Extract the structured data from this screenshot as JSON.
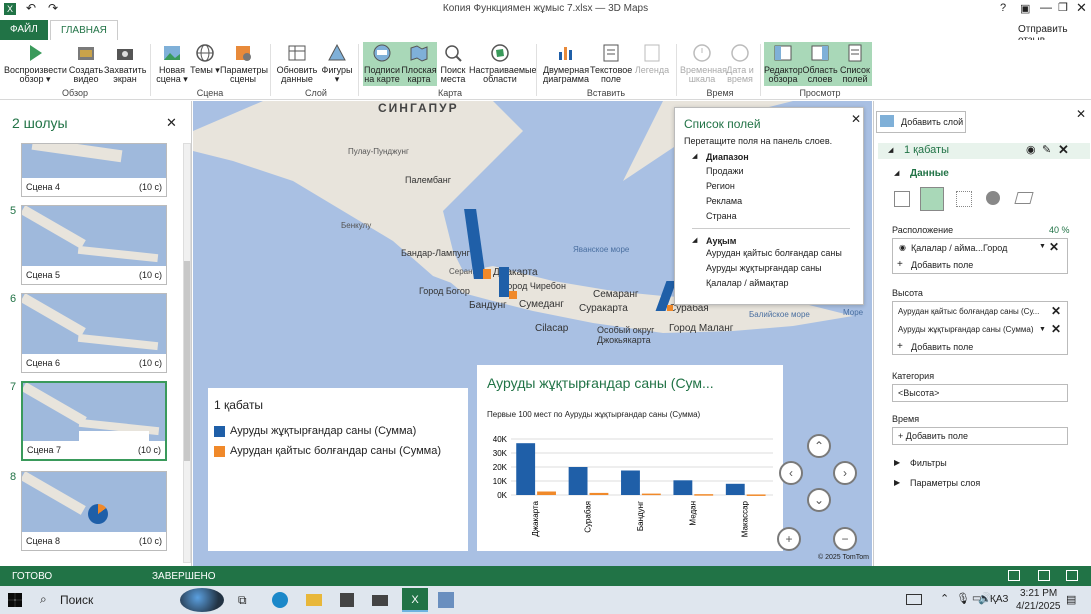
{
  "window": {
    "title": "Копия Функциямен жұмыс 7.xlsx — 3D Maps",
    "share": "Отправить отзыв"
  },
  "tabs": {
    "file": "ФАЙЛ",
    "home": "ГЛАВНАЯ"
  },
  "ribbon": {
    "buttons": [
      {
        "label": "Воспроизвести обзор ▾",
        "name": "play-tour-button"
      },
      {
        "label": "Создать видео",
        "name": "create-video-button"
      },
      {
        "label": "Захватить экран",
        "name": "capture-screen-button"
      },
      {
        "label": "Новая сцена ▾",
        "name": "new-scene-button"
      },
      {
        "label": "Темы ▾",
        "name": "themes-button"
      },
      {
        "label": "Параметры сцены",
        "name": "scene-options-button"
      },
      {
        "label": "Обновить данные",
        "name": "refresh-data-button"
      },
      {
        "label": "Фигуры ▾",
        "name": "shapes-button"
      },
      {
        "label": "Подписи на карте",
        "name": "map-labels-button"
      },
      {
        "label": "Плоская карта",
        "name": "flat-map-button"
      },
      {
        "label": "Поиск места",
        "name": "find-location-button"
      },
      {
        "label": "Настраиваемые области",
        "name": "custom-regions-button"
      },
      {
        "label": "Двумерная диаграмма",
        "name": "2d-chart-button"
      },
      {
        "label": "Текстовое поле",
        "name": "text-box-button"
      },
      {
        "label": "Легенда",
        "name": "legend-button"
      },
      {
        "label": "Временная шкала",
        "name": "timeline-button"
      },
      {
        "label": "Дата и время",
        "name": "date-time-button"
      },
      {
        "label": "Редактор обзора",
        "name": "tour-editor-button"
      },
      {
        "label": "Область слоев",
        "name": "layer-pane-button"
      },
      {
        "label": "Список полей",
        "name": "field-list-button"
      }
    ],
    "groups": [
      "Обзор",
      "Сцена",
      "Слой",
      "Карта",
      "Вставить",
      "Время",
      "Просмотр"
    ]
  },
  "left": {
    "header": "2 шолуы",
    "scenes": [
      {
        "num": "",
        "title": "Сцена 4",
        "dur": "(10 с)"
      },
      {
        "num": "5",
        "title": "Сцена 5",
        "dur": "(10 с)"
      },
      {
        "num": "6",
        "title": "Сцена 6",
        "dur": "(10 с)"
      },
      {
        "num": "7",
        "title": "Сцена 7",
        "dur": "(10 с)"
      },
      {
        "num": "8",
        "title": "Сцена 8",
        "dur": "(10 с)"
      }
    ]
  },
  "map": {
    "labels": [
      "СИНГАПУР",
      "Пулау-Пунджунг",
      "Палембанг",
      "Бенкулу",
      "Бандар-Лампунг",
      "Серанг",
      "Джакарта",
      "Город Богор",
      "Город Чиребон",
      "Бандунг",
      "Сумеданг",
      "Семаранг",
      "Суракарта",
      "Сурабая",
      "Город Маланг",
      "Cilacap",
      "Особый округ",
      "Джокьякарта",
      "Яванское море",
      "Балийское море",
      "Море"
    ],
    "copyright": "© 2025 TomTom",
    "field_list": {
      "title": "Список полей",
      "hint": "Перетащите поля на панель слоев.",
      "group1": "Диапазон",
      "items1": [
        "Продажи",
        "Регион",
        "Реклама",
        "Страна"
      ],
      "group2": "Ауқым",
      "items2": [
        "Аурудан қайтыс болғандар саны",
        "Ауруды жұқтырғандар саны",
        "Қалалар / аймақтар"
      ]
    },
    "legend": {
      "title": "1 қабаты",
      "items": [
        {
          "label": "Ауруды жұқтырғандар саны (Сумма)",
          "color": "#1f5fa8"
        },
        {
          "label": "Аурудан қайтыс болғандар саны (Сумма)",
          "color": "#f0892a"
        }
      ]
    },
    "chart": {
      "title": "Ауруды жұқтырғандар саны (Сум...",
      "subtitle": "Первые 100 мест  по Ауруды жұқтырғандар саны (Сумма)"
    }
  },
  "chart_data": {
    "type": "bar",
    "categories": [
      "Джакарта",
      "Сурабая",
      "Бандунг",
      "Медан",
      "Макассар"
    ],
    "series": [
      {
        "name": "Ауруды жұқтырғандар саны (Сумма)",
        "values": [
          37000,
          20000,
          17500,
          10500,
          8000
        ],
        "color": "#1f5fa8"
      },
      {
        "name": "Аурудан қайтыс болғандар саны (Сумма)",
        "values": [
          2500,
          1500,
          1000,
          600,
          400
        ],
        "color": "#f0892a"
      }
    ],
    "yticks": [
      "40K",
      "30K",
      "20K",
      "10K",
      "0K"
    ],
    "ylim": [
      0,
      40000
    ]
  },
  "right": {
    "add_layer": "Добавить слой",
    "layer_name": "1 қабаты",
    "data_header": "Данные",
    "location_label": "Расположение",
    "location_pct": "40 %",
    "location_field": "Қалалар / айма...",
    "location_type": "Город",
    "add_field": "Добавить поле",
    "height_label": "Высота",
    "height_fields": [
      "Аурудан қайтыс болғандар саны (Су...",
      "Ауруды жұқтырғандар саны (Сумма)"
    ],
    "category_label": "Категория",
    "category_value": "<Высота>",
    "time_label": "Время",
    "filters": "Фильтры",
    "layer_options": "Параметры слоя"
  },
  "status": {
    "left": "ГОТОВО",
    "mid": "ЗАВЕРШЕНО"
  },
  "taskbar": {
    "search": "Поиск",
    "lang": "ҚАЗ",
    "time": "3:21 PM",
    "date": "4/21/2025"
  }
}
